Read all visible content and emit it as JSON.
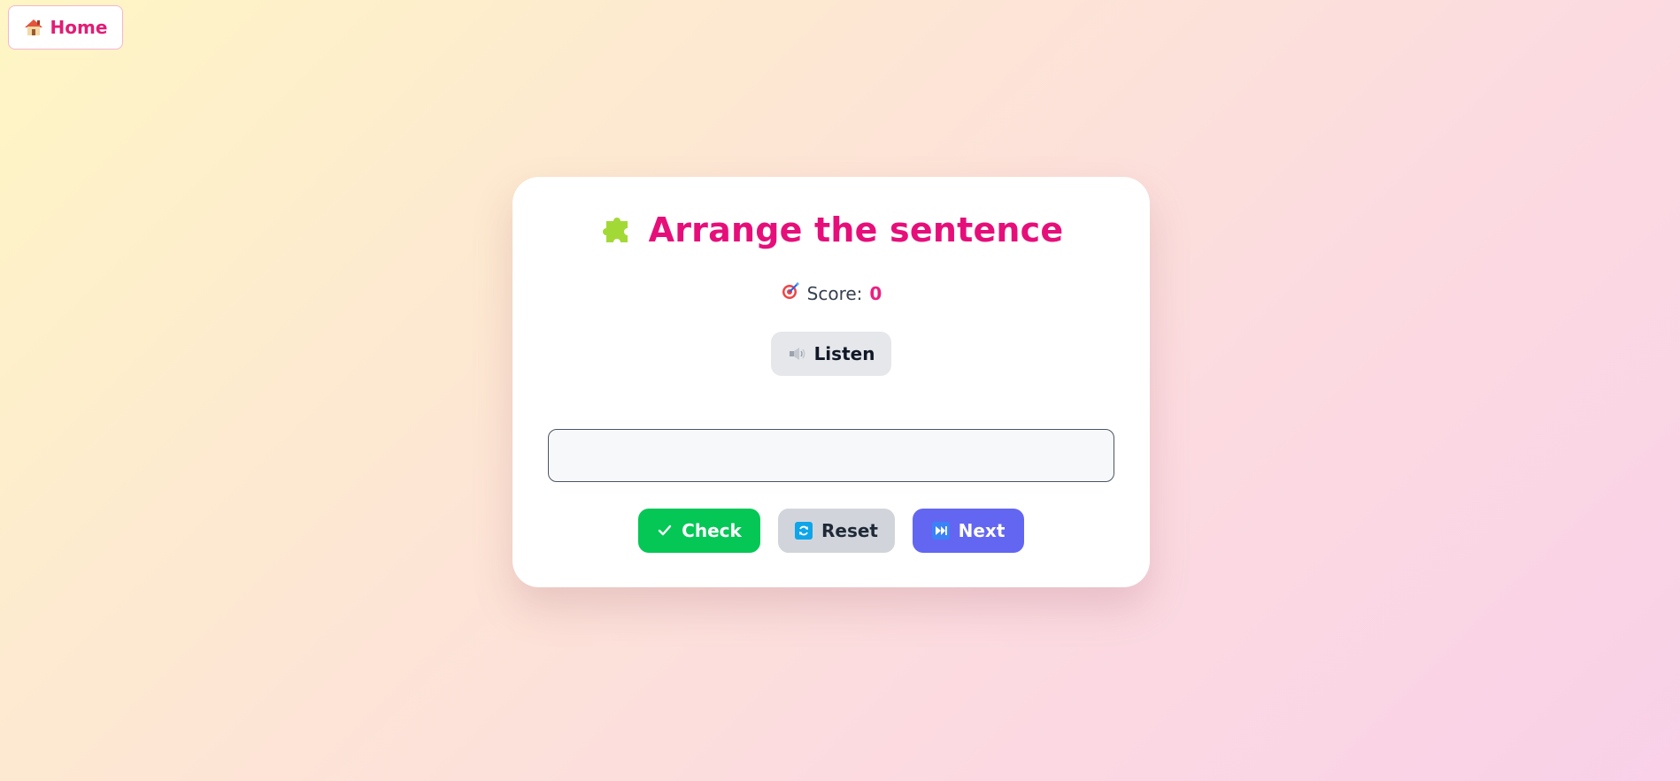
{
  "nav": {
    "home_label": "Home",
    "home_icon": "house-icon"
  },
  "game": {
    "title": "Arrange the sentence",
    "title_icon": "puzzle-piece-icon",
    "score_label": "Score:",
    "score_value": "0",
    "score_icon": "target-icon",
    "listen_label": "Listen",
    "listen_icon": "speaker-icon",
    "answer_value": ""
  },
  "actions": {
    "check_label": "Check",
    "check_icon": "checkmark-icon",
    "reset_label": "Reset",
    "reset_icon": "refresh-icon",
    "next_label": "Next",
    "next_icon": "skip-forward-icon"
  },
  "colors": {
    "accent_pink": "#e60f7a",
    "check_green": "#05c756",
    "next_indigo": "#6366f1",
    "reset_gray": "#d1d5db"
  }
}
